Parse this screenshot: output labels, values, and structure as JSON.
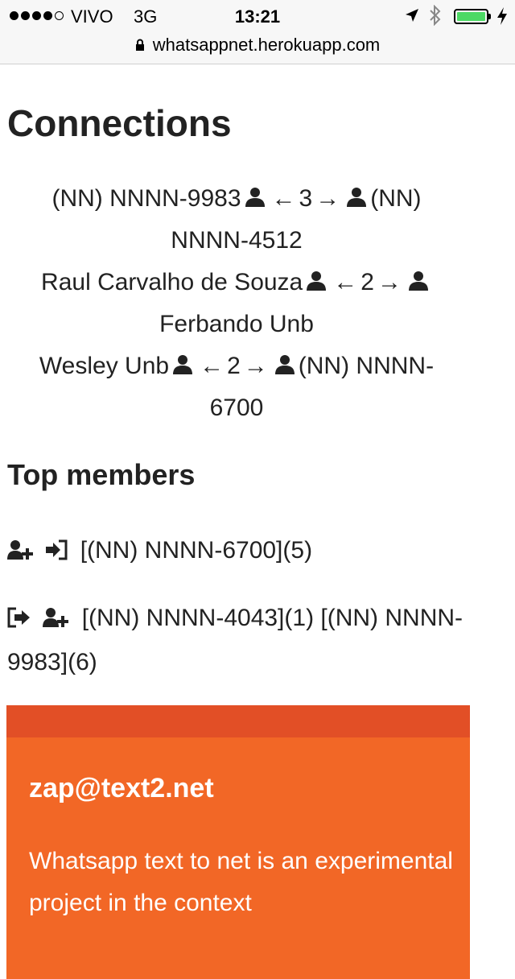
{
  "status_bar": {
    "carrier": "VIVO",
    "network": "3G",
    "time": "13:21",
    "battery_level": 1.0,
    "battery_color": "#4cd964"
  },
  "browser": {
    "url": "whatsappnet.herokuapp.com",
    "lock_icon": "lock-icon"
  },
  "connections": {
    "title": "Connections",
    "icon": "user-icon",
    "items": [
      {
        "from": "(NN) NNNN-9983",
        "count": "3",
        "to": "(NN) NNNN-4512"
      },
      {
        "from": "Raul Carvalho de Souza",
        "count": "2",
        "to": "Ferbando Unb"
      },
      {
        "from": "Wesley Unb",
        "count": "2",
        "to": "(NN) NNNN-6700"
      }
    ],
    "arrow_left": "←",
    "arrow_right": "→"
  },
  "top_members": {
    "title": "Top members",
    "rows": [
      {
        "icons": [
          "user-plus-icon",
          "sign-in-icon"
        ],
        "text": "[(NN) NNNN-6700](5)"
      },
      {
        "icons": [
          "sign-out-icon",
          "user-plus-icon"
        ],
        "text": "[(NN) NNNN-4043](1) [(NN) NNNN-9983](6)"
      }
    ]
  },
  "card": {
    "title": "zap@text2.net",
    "text": "Whatsapp text to net is an experimental project in the context",
    "color": "#f26726",
    "header_color": "#e24f26"
  }
}
